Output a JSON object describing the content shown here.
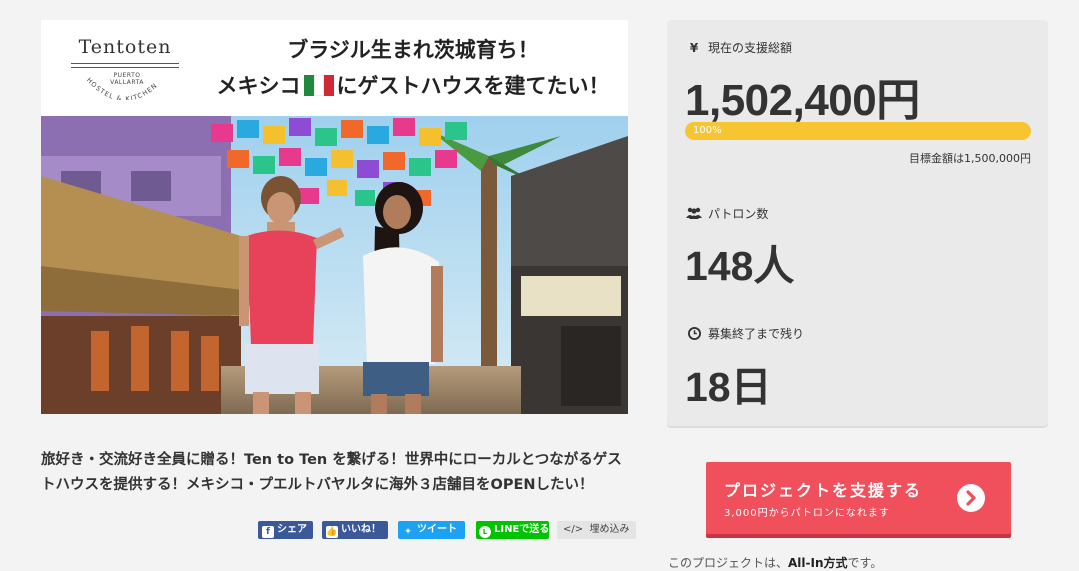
{
  "hero": {
    "logo_name": "Tentoten",
    "logo_sub": "PUERTO VALLARTA",
    "logo_arc": "HOSTEL & KITCHEN",
    "headline_line1": "ブラジル生まれ茨城育ち！",
    "headline_line2a": "メキシコ",
    "headline_line2b": "にゲストハウスを建てたい！",
    "flag_colors": [
      "#1f8a3d",
      "#ffffff",
      "#ce2b37"
    ]
  },
  "description": "旅好き・交流好き全員に贈る！Ten to Ten を繋げる！世界中にローカルとつながるゲストハウスを提供する！メキシコ・プエルトバヤルタに海外３店舗目をOPENしたい！",
  "share": {
    "facebook": "シェア",
    "like": "いいね！",
    "tweet": "ツイート",
    "line": "LINEで送る",
    "embed": "埋め込み",
    "colors": {
      "facebook": "#3b5998",
      "twitter": "#1da1f2",
      "line": "#00c300"
    }
  },
  "stats": {
    "funded_label": "現在の支援総額",
    "funded_value": "1,502,400円",
    "progress_percent": 100,
    "progress_label": "100%",
    "goal_text": "目標金額は1,500,000円",
    "patrons_label": "パトロン数",
    "patrons_value": "148人",
    "remaining_label": "募集終了まで残り",
    "remaining_value": "18日"
  },
  "cta": {
    "main": "プロジェクトを支援する",
    "sub": "3,000円からパトロンになれます",
    "color": "#f04f5c"
  },
  "note": {
    "prefix": "このプロジェクトは、",
    "type": "All-In方式",
    "suffix": "です。"
  }
}
